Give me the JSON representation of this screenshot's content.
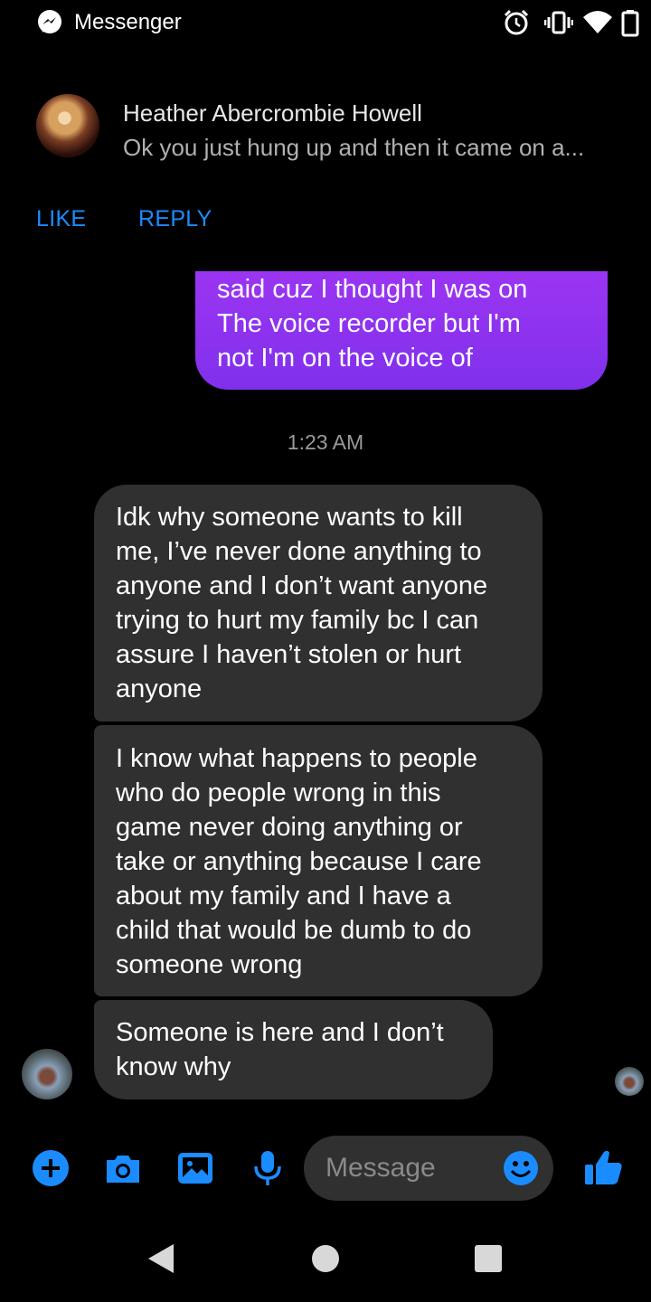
{
  "status_bar": {
    "app_name": "Messenger",
    "icons": [
      "messenger-icon",
      "alarm-icon",
      "vibrate-icon",
      "wifi-icon",
      "battery-icon"
    ]
  },
  "notification": {
    "sender": "Heather Abercrombie Howell",
    "preview": "Ok you just hung up and then it came on a...",
    "actions": {
      "like": "LIKE",
      "reply": "REPLY"
    }
  },
  "chat": {
    "sent_message": "said cuz I thought I was on\nThe voice recorder but I'm\nnot I'm on the voice of",
    "timestamp": "1:23 AM",
    "received_messages": [
      "Idk why someone wants to kill\nme, I’ve never done anything to\nanyone and I don’t want anyone\ntrying to hurt my family bc I can\nassure I haven’t stolen or hurt\nanyone",
      "I know what happens to people\nwho do people wrong in this\ngame never doing anything or\ntake or anything because I care\nabout my family and I have a\nchild that would be dumb to do\nsomeone wrong",
      "Someone is here and I don’t\nknow why"
    ]
  },
  "composer": {
    "placeholder": "Message",
    "value": "",
    "icons": [
      "add-icon",
      "camera-icon",
      "gallery-icon",
      "mic-icon",
      "emoji-icon",
      "thumbs-up-icon"
    ]
  },
  "nav_bar": {
    "icons": [
      "back-icon",
      "home-icon",
      "recents-icon"
    ]
  },
  "colors": {
    "background": "#000000",
    "accent_blue": "#1a8cff",
    "sent_bubble": "#8a34ef",
    "received_bubble": "#303030",
    "muted_text": "#9a9a9a"
  }
}
